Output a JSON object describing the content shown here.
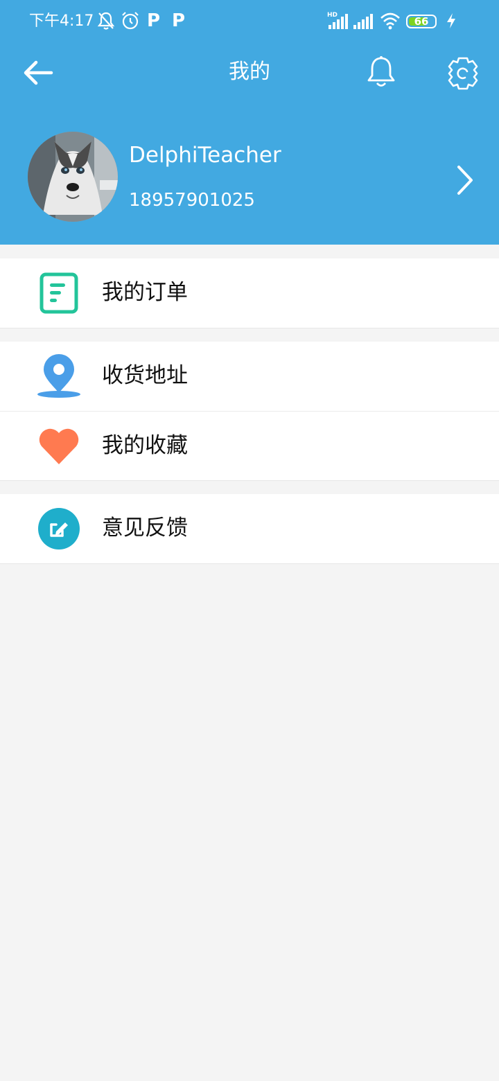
{
  "status_bar": {
    "time": "下午4:17",
    "left_icons": [
      "bell-muted-icon",
      "alarm-clock-icon",
      "p-app-icon",
      "p-app-icon"
    ],
    "p_letter": "P",
    "network_label": "HD",
    "battery_level": "66",
    "right_icons": [
      "signal-hd-icon",
      "signal-icon",
      "wifi-icon",
      "battery-icon",
      "charging-icon"
    ]
  },
  "toolbar": {
    "title": "我的",
    "icons": [
      "arrow-left-icon",
      "bell-icon",
      "gear-icon"
    ]
  },
  "profile": {
    "username": "DelphiTeacher",
    "phone": "18957901025",
    "avatar_icon": "husky-dog-avatar",
    "chevron_icon": "chevron-right-icon"
  },
  "menu": {
    "groups": [
      [
        {
          "label": "我的订单",
          "icon": "order-document-icon",
          "icon_color": "#23c49a"
        }
      ],
      [
        {
          "label": "收货地址",
          "icon": "location-pin-icon",
          "icon_color": "#4a9ee8"
        },
        {
          "label": "我的收藏",
          "icon": "heart-icon",
          "icon_color": "#ff7a50"
        }
      ],
      [
        {
          "label": "意见反馈",
          "icon": "feedback-edit-icon",
          "icon_color": "#1faecb"
        }
      ]
    ]
  },
  "colors": {
    "header": "#42a9e1",
    "page_background": "#f4f4f4",
    "battery_fill": "#7ed321"
  }
}
